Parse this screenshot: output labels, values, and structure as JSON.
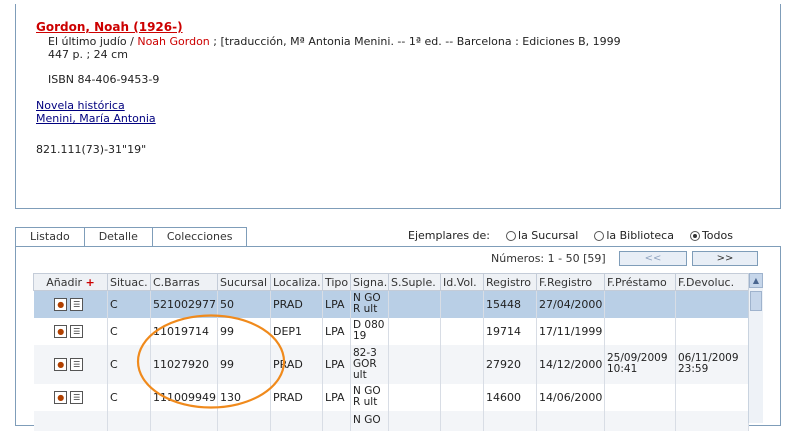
{
  "record": {
    "author": "Gordon, Noah (1926-)",
    "title_pre": "El último judío / ",
    "title_author": "Noah Gordon",
    "title_post": " ; [traducción, Mª Antonia Menini. -- 1ª ed. -- Barcelona : Ediciones B, 1999",
    "extent": "447 p. ; 24 cm",
    "isbn": "ISBN 84-406-9453-9",
    "subject": "Novela histórica",
    "added_author": "Menini, María Antonia",
    "classification": "821.111(73)-31\"19\""
  },
  "tabs": [
    "Listado",
    "Detalle",
    "Colecciones"
  ],
  "ejemplares": {
    "label": "Ejemplares de:",
    "options": [
      "la Sucursal",
      "la Biblioteca",
      "Todos"
    ],
    "selected": "Todos"
  },
  "pagination": {
    "numeros": "Números: 1 - 50 [59]",
    "prev": "<<",
    "next": ">>"
  },
  "columns": {
    "anadir": "Añadir",
    "plus": "+",
    "situac": "Situac.",
    "cbarras": "C.Barras",
    "sucursal": "Sucursal",
    "localiza": "Localiza.",
    "tipo": "Tipo",
    "signa": "Signa.",
    "ssuple": "S.Suple.",
    "idvol": "Id.Vol.",
    "registro": "Registro",
    "fregistro": "F.Registro",
    "fprestamo": "F.Préstamo",
    "fdevoluc": "F.Devoluc."
  },
  "rows": [
    {
      "situac": "C",
      "cbarras": "521002977",
      "sucursal": "50",
      "localiza": "PRAD",
      "tipo": "LPA",
      "signa": "N GO R ult",
      "registro": "15448",
      "fregistro": "27/04/2000",
      "fprestamo": "",
      "fdevoluc": ""
    },
    {
      "situac": "C",
      "cbarras": "11019714",
      "sucursal": "99",
      "localiza": "DEP1",
      "tipo": "LPA",
      "signa": "D 080 19",
      "registro": "19714",
      "fregistro": "17/11/1999",
      "fprestamo": "",
      "fdevoluc": ""
    },
    {
      "situac": "C",
      "cbarras": "11027920",
      "sucursal": "99",
      "localiza": "PRAD",
      "tipo": "LPA",
      "signa": "82-3 GOR ult",
      "registro": "27920",
      "fregistro": "14/12/2000",
      "fprestamo": "25/09/2009 10:41",
      "fdevoluc": "06/11/2009 23:59"
    },
    {
      "situac": "C",
      "cbarras": "111009949",
      "sucursal": "130",
      "localiza": "PRAD",
      "tipo": "LPA",
      "signa": "N GO R ult",
      "registro": "14600",
      "fregistro": "14/06/2000",
      "fprestamo": "",
      "fdevoluc": ""
    },
    {
      "situac": "",
      "cbarras": "",
      "sucursal": "",
      "localiza": "",
      "tipo": "",
      "signa": "N GO",
      "registro": "",
      "fregistro": "",
      "fprestamo": "",
      "fdevoluc": ""
    }
  ],
  "colors": {
    "accent_red": "#cc0000",
    "selected_row": "#b9cfe6",
    "annotation_orange": "#f08a1c"
  }
}
